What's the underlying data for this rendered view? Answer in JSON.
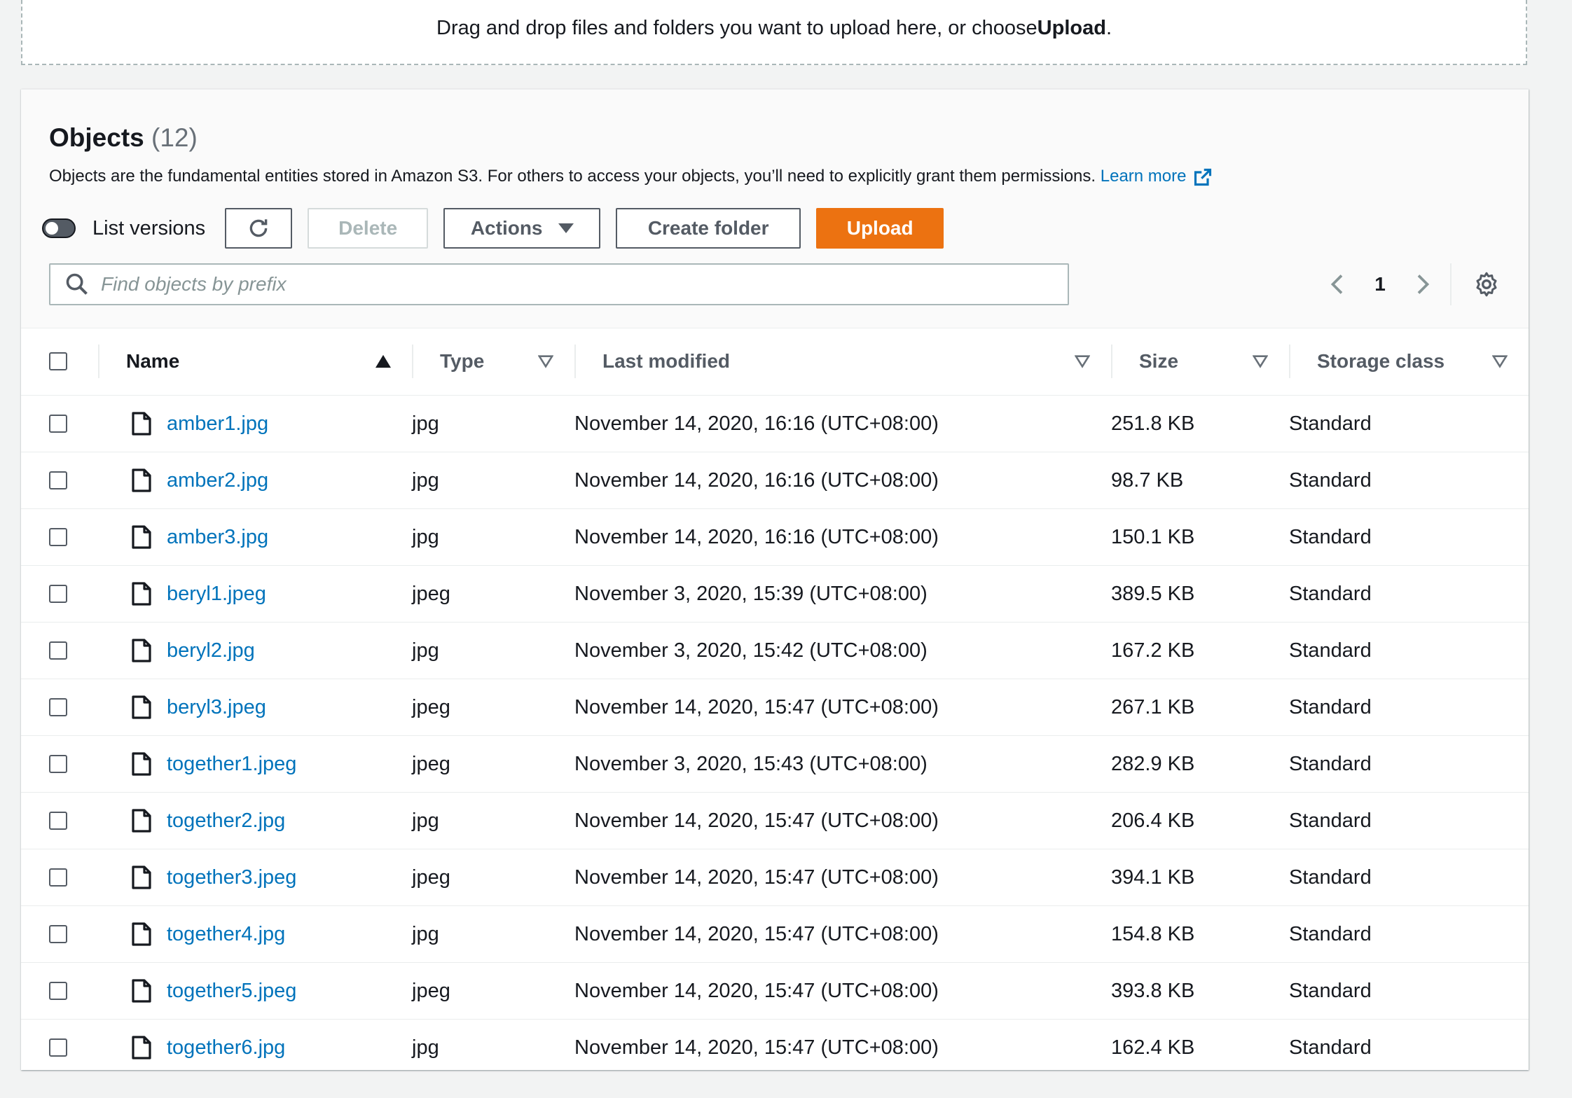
{
  "dropzone": {
    "text": "Drag and drop files and folders you want to upload here, or choose ",
    "bold": "Upload",
    "end": "."
  },
  "objects": {
    "title": "Objects",
    "count": "(12)",
    "description": "Objects are the fundamental entities stored in Amazon S3. For others to access your objects, you’ll need to explicitly grant them permissions.",
    "learn_more": "Learn more"
  },
  "toolbar": {
    "list_versions": "List versions",
    "delete": "Delete",
    "actions": "Actions",
    "create_folder": "Create folder",
    "upload": "Upload"
  },
  "search": {
    "placeholder": "Find objects by prefix"
  },
  "pagination": {
    "page": "1"
  },
  "table": {
    "columns": [
      "Name",
      "Type",
      "Last modified",
      "Size",
      "Storage class"
    ],
    "rows": [
      {
        "name": "amber1.jpg",
        "type": "jpg",
        "modified": "November 14, 2020, 16:16 (UTC+08:00)",
        "size": "251.8 KB",
        "storage": "Standard"
      },
      {
        "name": "amber2.jpg",
        "type": "jpg",
        "modified": "November 14, 2020, 16:16 (UTC+08:00)",
        "size": "98.7 KB",
        "storage": "Standard"
      },
      {
        "name": "amber3.jpg",
        "type": "jpg",
        "modified": "November 14, 2020, 16:16 (UTC+08:00)",
        "size": "150.1 KB",
        "storage": "Standard"
      },
      {
        "name": "beryl1.jpeg",
        "type": "jpeg",
        "modified": "November 3, 2020, 15:39 (UTC+08:00)",
        "size": "389.5 KB",
        "storage": "Standard"
      },
      {
        "name": "beryl2.jpg",
        "type": "jpg",
        "modified": "November 3, 2020, 15:42 (UTC+08:00)",
        "size": "167.2 KB",
        "storage": "Standard"
      },
      {
        "name": "beryl3.jpeg",
        "type": "jpeg",
        "modified": "November 14, 2020, 15:47 (UTC+08:00)",
        "size": "267.1 KB",
        "storage": "Standard"
      },
      {
        "name": "together1.jpeg",
        "type": "jpeg",
        "modified": "November 3, 2020, 15:43 (UTC+08:00)",
        "size": "282.9 KB",
        "storage": "Standard"
      },
      {
        "name": "together2.jpg",
        "type": "jpg",
        "modified": "November 14, 2020, 15:47 (UTC+08:00)",
        "size": "206.4 KB",
        "storage": "Standard"
      },
      {
        "name": "together3.jpeg",
        "type": "jpeg",
        "modified": "November 14, 2020, 15:47 (UTC+08:00)",
        "size": "394.1 KB",
        "storage": "Standard"
      },
      {
        "name": "together4.jpg",
        "type": "jpg",
        "modified": "November 14, 2020, 15:47 (UTC+08:00)",
        "size": "154.8 KB",
        "storage": "Standard"
      },
      {
        "name": "together5.jpeg",
        "type": "jpeg",
        "modified": "November 14, 2020, 15:47 (UTC+08:00)",
        "size": "393.8 KB",
        "storage": "Standard"
      },
      {
        "name": "together6.jpg",
        "type": "jpg",
        "modified": "November 14, 2020, 15:47 (UTC+08:00)",
        "size": "162.4 KB",
        "storage": "Standard"
      }
    ]
  },
  "icons": {
    "refresh": "refresh-icon",
    "search": "search-icon",
    "external_link": "external-link-icon",
    "file": "file-icon",
    "settings": "gear-icon"
  },
  "colors": {
    "link": "#0073bb",
    "primary": "#ec7211",
    "background": "#f2f3f3"
  }
}
